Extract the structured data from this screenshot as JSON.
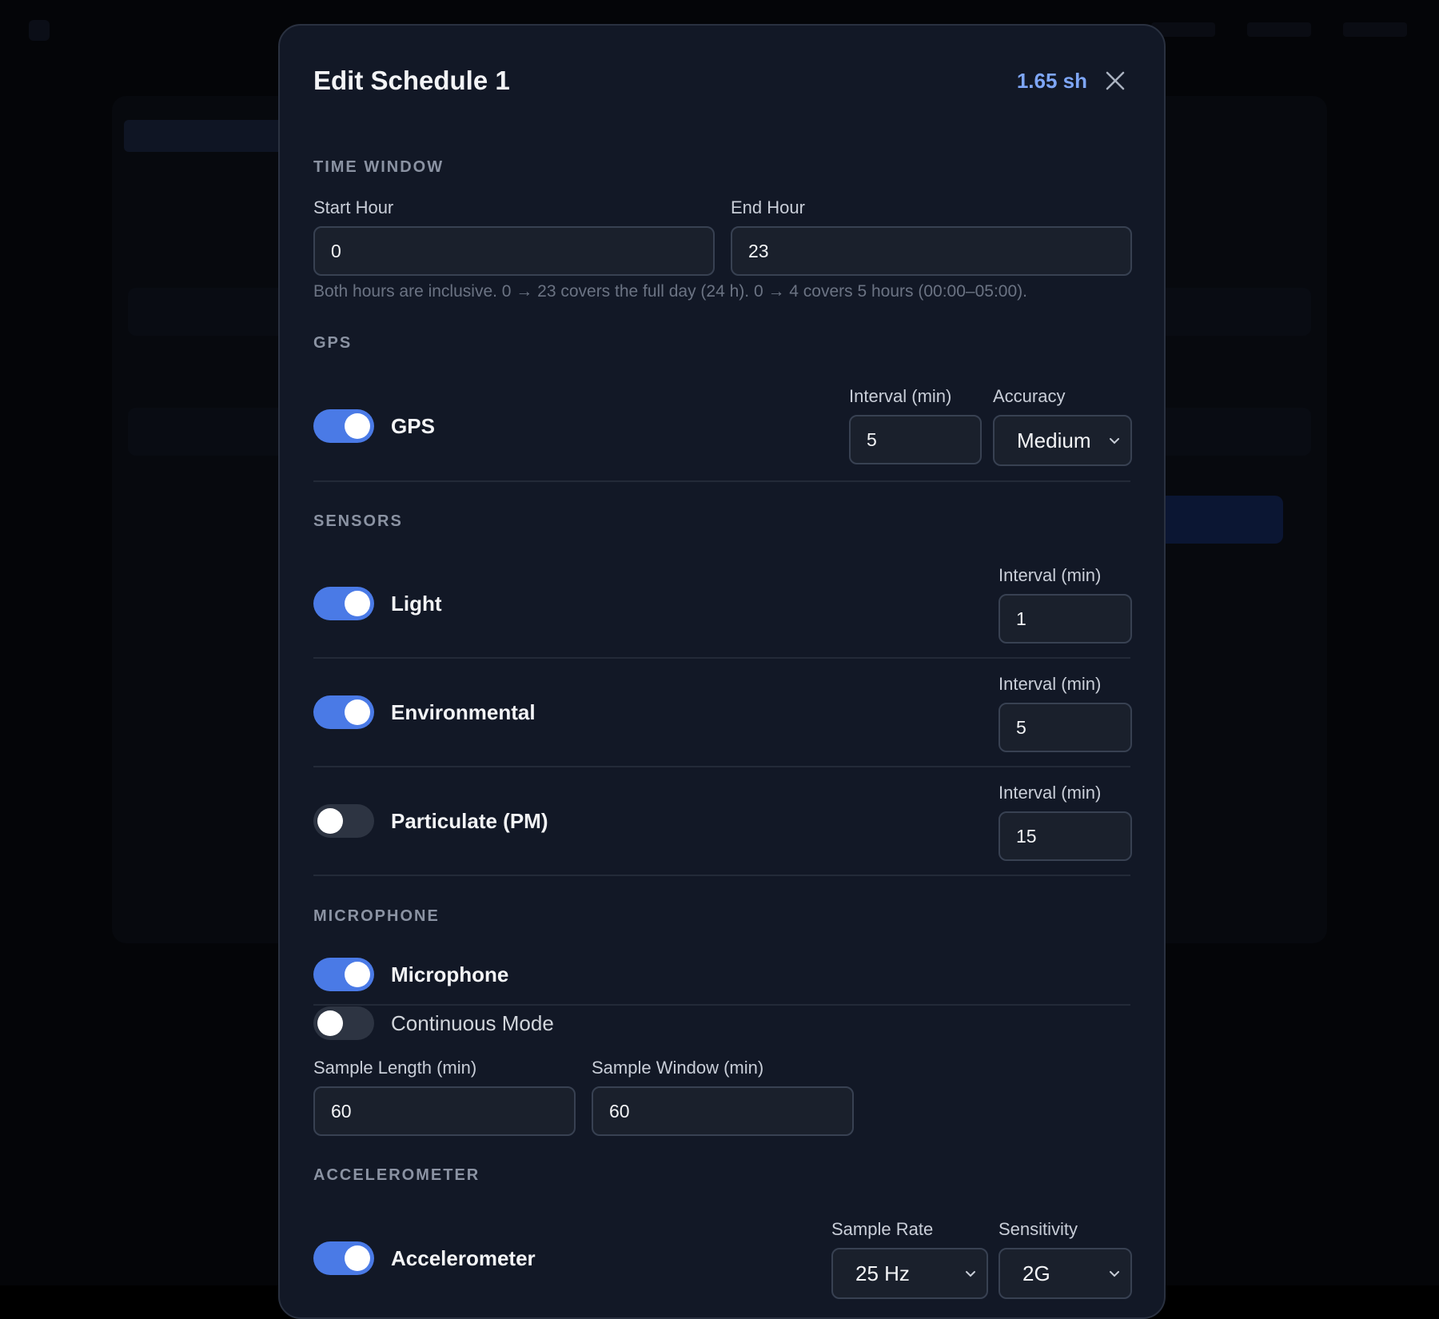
{
  "modal": {
    "title": "Edit Schedule 1",
    "metric": "1.65 sh",
    "close_icon": "close-icon"
  },
  "time_window": {
    "section_label": "TIME WINDOW",
    "start_label": "Start Hour",
    "start_value": "0",
    "end_label": "End Hour",
    "end_value": "23",
    "hint": "Both hours are inclusive. 0 → 23 covers the full day (24 h). 0 → 4 covers 5 hours (00:00–05:00)."
  },
  "gps": {
    "section_label": "GPS",
    "toggle_label": "GPS",
    "enabled": true,
    "interval_label": "Interval (min)",
    "interval_value": "5",
    "accuracy_label": "Accuracy",
    "accuracy_value": "Medium"
  },
  "sensors": {
    "section_label": "SENSORS",
    "items": [
      {
        "label": "Light",
        "enabled": true,
        "interval_label": "Interval (min)",
        "interval_value": "1"
      },
      {
        "label": "Environmental",
        "enabled": true,
        "interval_label": "Interval (min)",
        "interval_value": "5"
      },
      {
        "label": "Particulate (PM)",
        "enabled": false,
        "interval_label": "Interval (min)",
        "interval_value": "15"
      }
    ]
  },
  "microphone": {
    "section_label": "MICROPHONE",
    "toggle_label": "Microphone",
    "enabled": true,
    "continuous_label": "Continuous Mode",
    "continuous_enabled": false,
    "sample_length_label": "Sample Length (min)",
    "sample_length_value": "60",
    "sample_window_label": "Sample Window (min)",
    "sample_window_value": "60"
  },
  "accelerometer": {
    "section_label": "ACCELEROMETER",
    "toggle_label": "Accelerometer",
    "enabled": true,
    "sample_rate_label": "Sample Rate",
    "sample_rate_value": "25 Hz",
    "sensitivity_label": "Sensitivity",
    "sensitivity_value": "2G"
  },
  "colors": {
    "accent": "#4a7ae6",
    "metric": "#7ea6f7",
    "modal_bg": "#121826"
  }
}
